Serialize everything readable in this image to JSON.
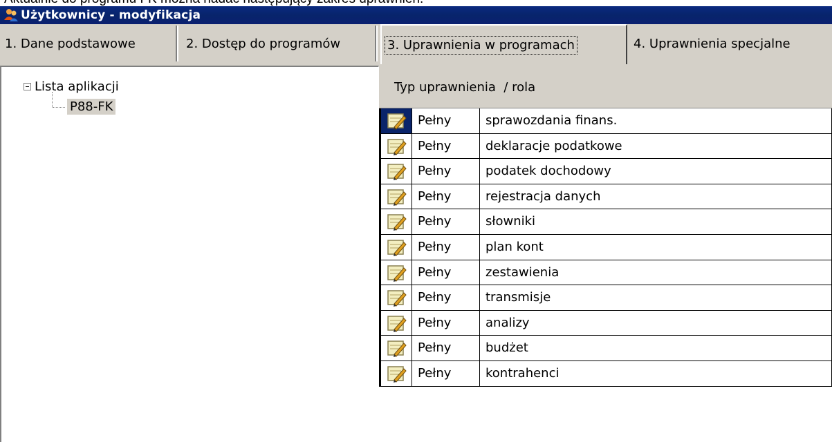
{
  "doc_fragment": "Aktualnie do programu FK można nadać następujący zakres uprawnień:",
  "window": {
    "title": "Użytkownicy - modyfikacja",
    "icon": "users-icon"
  },
  "tabs": [
    {
      "label": "1. Dane podstawowe",
      "active": false
    },
    {
      "label": "2. Dostęp do programów",
      "active": false
    },
    {
      "label": "3. Uprawnienia w programach",
      "active": true
    },
    {
      "label": "4. Uprawnienia specjalne",
      "active": false
    }
  ],
  "tree": {
    "root": "Lista aplikacji",
    "child": "P88-FK"
  },
  "grid": {
    "header": "Typ uprawnienia  / rola",
    "row_icon": "edit-permission-icon",
    "rows": [
      {
        "type": "Pełny",
        "role": "sprawozdania finans."
      },
      {
        "type": "Pełny",
        "role": "deklaracje podatkowe"
      },
      {
        "type": "Pełny",
        "role": "podatek dochodowy"
      },
      {
        "type": "Pełny",
        "role": "rejestracja danych"
      },
      {
        "type": "Pełny",
        "role": "słowniki"
      },
      {
        "type": "Pełny",
        "role": "plan kont"
      },
      {
        "type": "Pełny",
        "role": "zestawienia"
      },
      {
        "type": "Pełny",
        "role": "transmisje"
      },
      {
        "type": "Pełny",
        "role": "analizy"
      },
      {
        "type": "Pełny",
        "role": "budżet"
      },
      {
        "type": "Pełny",
        "role": "kontrahenci"
      }
    ]
  },
  "colors": {
    "titlebar": "#0a246a",
    "face": "#d4d0c8",
    "selection": "#0a246a"
  }
}
